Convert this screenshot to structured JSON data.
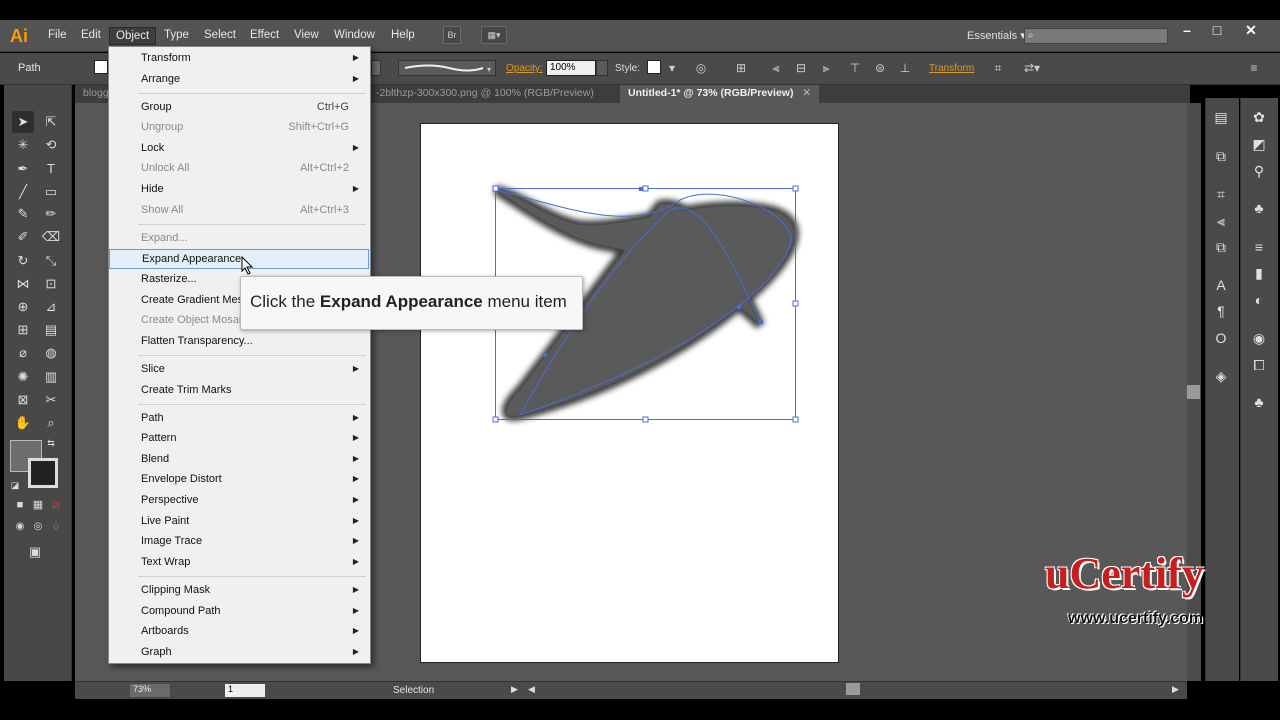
{
  "menubar": {
    "app_logo": "Ai",
    "items": [
      "File",
      "Edit",
      "Object",
      "Type",
      "Select",
      "Effect",
      "View",
      "Window",
      "Help"
    ],
    "bridge_label": "Br",
    "workspace": "Essentials"
  },
  "controlbar": {
    "object_type": "Path",
    "opacity_label": "Opacity:",
    "opacity_value": "100%",
    "style_label": "Style:",
    "transform_link": "Transform"
  },
  "tabs": [
    {
      "label": "blogg"
    },
    {
      "label": "-2blthzp-300x300.png @ 100% (RGB/Preview)"
    },
    {
      "label": "Untitled-1* @ 73% (RGB/Preview)"
    }
  ],
  "object_menu": {
    "items": [
      {
        "label": "Transform",
        "submenu": true
      },
      {
        "label": "Arrange",
        "submenu": true
      },
      {
        "label": "Group",
        "shortcut": "Ctrl+G"
      },
      {
        "label": "Ungroup",
        "shortcut": "Shift+Ctrl+G",
        "disabled": true
      },
      {
        "label": "Lock",
        "submenu": true
      },
      {
        "label": "Unlock All",
        "shortcut": "Alt+Ctrl+2",
        "disabled": true
      },
      {
        "label": "Hide",
        "submenu": true
      },
      {
        "label": "Show All",
        "shortcut": "Alt+Ctrl+3",
        "disabled": true
      },
      {
        "label": "Expand...",
        "disabled": true
      },
      {
        "label": "Expand Appearance",
        "highlight": true
      },
      {
        "label": "Rasterize..."
      },
      {
        "label": "Create Gradient Mesh..."
      },
      {
        "label": "Create Object Mosaic...",
        "disabled": true
      },
      {
        "label": "Flatten Transparency..."
      },
      {
        "label": "Slice",
        "submenu": true
      },
      {
        "label": "Create Trim Marks"
      },
      {
        "label": "Path",
        "submenu": true
      },
      {
        "label": "Pattern",
        "submenu": true
      },
      {
        "label": "Blend",
        "submenu": true
      },
      {
        "label": "Envelope Distort",
        "submenu": true
      },
      {
        "label": "Perspective",
        "submenu": true
      },
      {
        "label": "Live Paint",
        "submenu": true
      },
      {
        "label": "Image Trace",
        "submenu": true
      },
      {
        "label": "Text Wrap",
        "submenu": true
      },
      {
        "label": "Clipping Mask",
        "submenu": true
      },
      {
        "label": "Compound Path",
        "submenu": true
      },
      {
        "label": "Artboards",
        "submenu": true
      },
      {
        "label": "Graph",
        "submenu": true
      }
    ]
  },
  "tooltip": {
    "prefix": "Click the ",
    "bold": "Expand Appearance",
    "suffix": " menu item"
  },
  "statusbar": {
    "zoom": "73%",
    "page": "1",
    "tool": "Selection"
  },
  "watermark": {
    "logo": "uCertify",
    "url": "www.ucertify.com"
  },
  "colors": {
    "accent_orange": "#d79a2a",
    "app_logo": "#ff9a00",
    "watermark_red": "#c81e1e",
    "selection_blue": "#4a6cd4"
  }
}
